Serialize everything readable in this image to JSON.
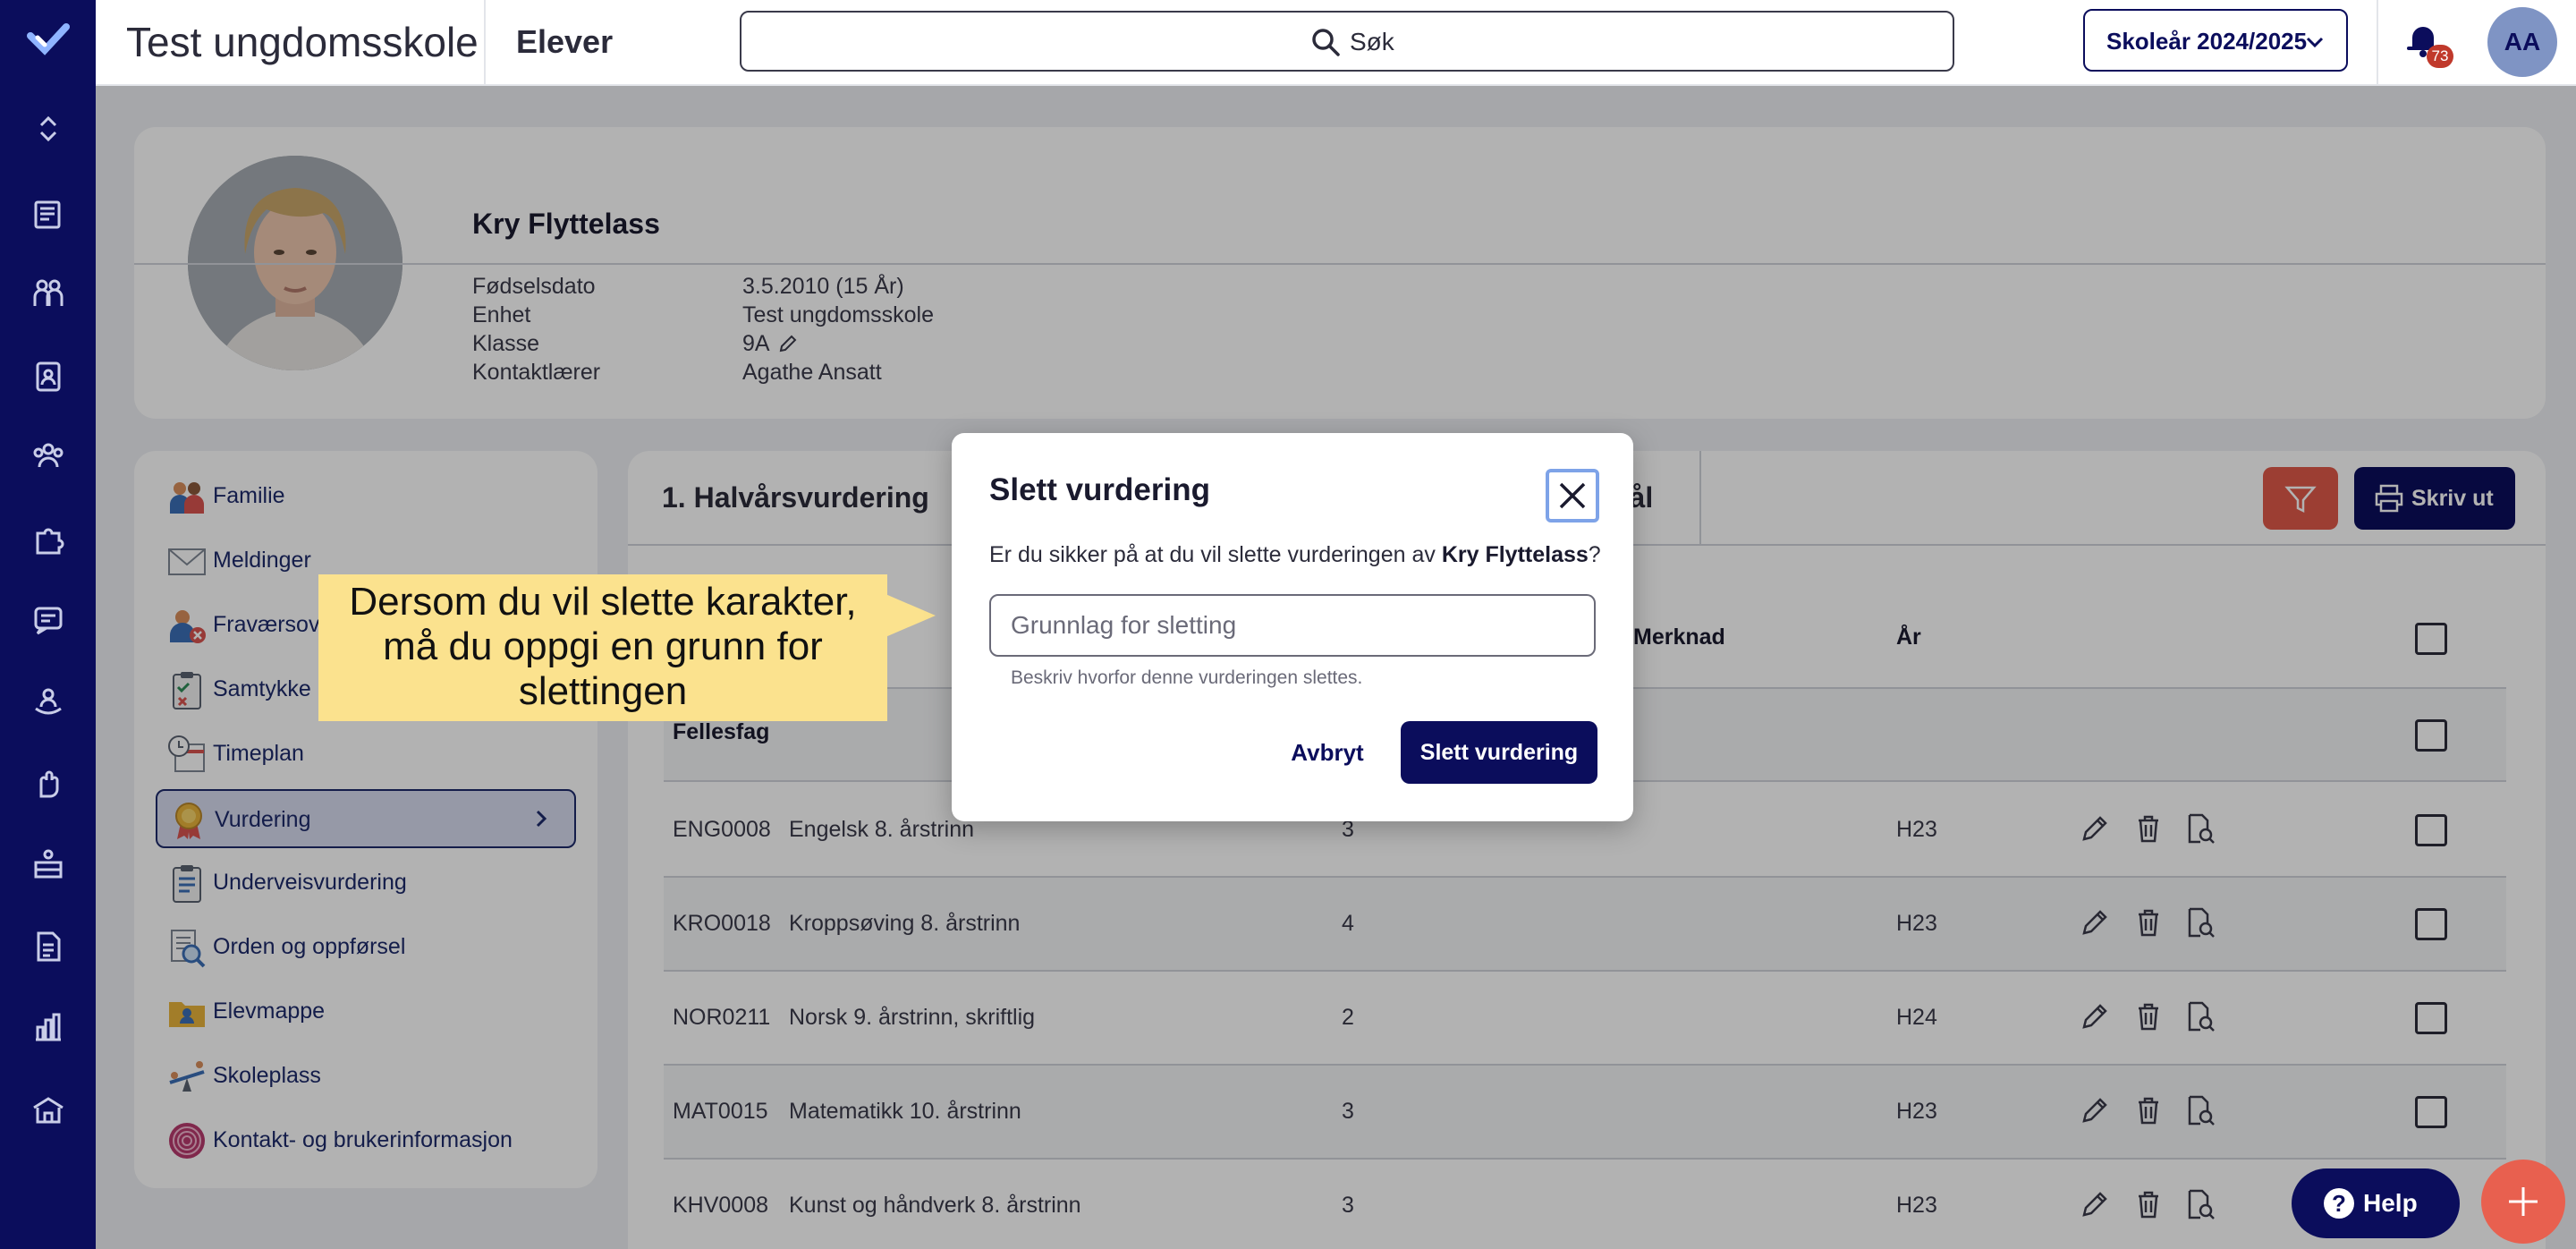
{
  "topbar": {
    "school_name": "Test ungdomsskole",
    "section": "Elever",
    "search_label": "Søk",
    "school_year": "Skoleår 2024/2025",
    "notification_count": "73",
    "user_initials": "AA"
  },
  "profile": {
    "name": "Kry Flyttelass",
    "fields": [
      {
        "label": "Fødselsdato",
        "value": "3.5.2010 (15 År)"
      },
      {
        "label": "Enhet",
        "value": "Test ungdomsskole"
      },
      {
        "label": "Klasse",
        "value": "9A"
      },
      {
        "label": "Kontaktlærer",
        "value": "Agathe Ansatt"
      }
    ]
  },
  "sidemenu": {
    "items": [
      {
        "label": "Familie",
        "icon": "family-icon"
      },
      {
        "label": "Meldinger",
        "icon": "envelope-icon"
      },
      {
        "label": "Fraværsoversikt",
        "icon": "absence-icon"
      },
      {
        "label": "Samtykke",
        "icon": "clipboard-check-icon"
      },
      {
        "label": "Timeplan",
        "icon": "clock-calendar-icon"
      },
      {
        "label": "Vurdering",
        "icon": "medal-icon"
      },
      {
        "label": "Underveisvurdering",
        "icon": "clipboard-list-icon"
      },
      {
        "label": "Orden og oppførsel",
        "icon": "magnifier-document-icon"
      },
      {
        "label": "Elevmappe",
        "icon": "folder-person-icon"
      },
      {
        "label": "Skoleplass",
        "icon": "seesaw-icon"
      },
      {
        "label": "Kontakt- og brukerinformasjon",
        "icon": "fingerprint-icon"
      }
    ],
    "active_index": 5
  },
  "main": {
    "tab_first": "1. Halvårsvurdering",
    "tab_partial": "nål",
    "print_label": "Skriv ut",
    "columns": {
      "note": "Merknad",
      "year": "År"
    },
    "group_label": "Fellesfag",
    "rows": [
      {
        "code": "ENG0008",
        "subject": "Engelsk 8. årstrinn",
        "grade": "3",
        "year": "H23"
      },
      {
        "code": "KRO0018",
        "subject": "Kroppsøving 8. årstrinn",
        "grade": "4",
        "year": "H23"
      },
      {
        "code": "NOR0211",
        "subject": "Norsk 9. årstrinn, skriftlig",
        "grade": "2",
        "year": "H24"
      },
      {
        "code": "MAT0015",
        "subject": "Matematikk 10. årstrinn",
        "grade": "3",
        "year": "H23"
      },
      {
        "code": "KHV0008",
        "subject": "Kunst og håndverk 8. årstrinn",
        "grade": "3",
        "year": "H23"
      }
    ]
  },
  "modal": {
    "title": "Slett vurdering",
    "question_prefix": "Er du sikker på at du vil slette vurderingen av ",
    "student_name": "Kry Flyttelass",
    "question_suffix": "?",
    "input_placeholder": "Grunnlag for sletting",
    "input_value": "",
    "helper_text": "Beskriv hvorfor denne vurderingen slettes.",
    "cancel_label": "Avbryt",
    "confirm_label": "Slett vurdering"
  },
  "callout": {
    "text": "Dersom du vil slette karakter, må du oppgi en grunn for slettingen"
  },
  "floating": {
    "help_label": "Help"
  },
  "colors": {
    "navy": "#0b0d5c",
    "filter_red": "#e05a4a",
    "fab_coral": "#e8604f",
    "callout_yellow": "#fbe28e",
    "badge_red": "#c0392b"
  }
}
